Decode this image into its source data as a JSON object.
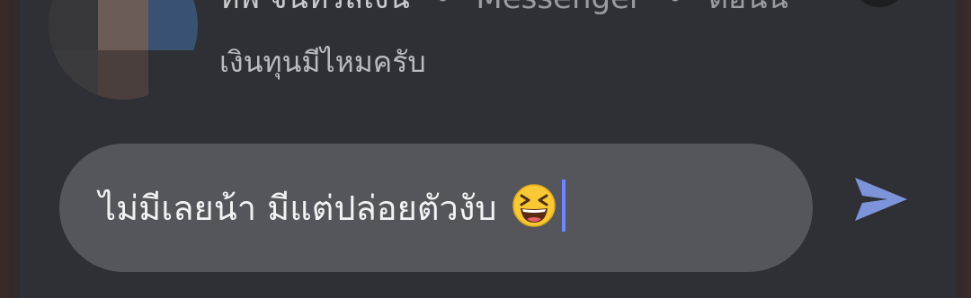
{
  "notification": {
    "sender_name": "ทิพ จันทร์สีเงิน",
    "separator": "•",
    "app_name": "Messenger",
    "separator2": "•",
    "time": "ตอนนี้",
    "message_preview": "เงินทุนมีไหมครับ",
    "avatar_colors": [
      "#a7a8ab",
      "#3a3439",
      "#2f3036",
      "#37363a",
      "#6b5b57",
      "#3a5272",
      "#3b3a3d",
      "#4a3f3c",
      "#2f3036"
    ]
  },
  "reply": {
    "input_text": "ไม่มีเลยน้า มีแต่ปล่อยตัวงับ",
    "emoji": "laughing-face-emoji",
    "send_icon": "send-icon",
    "accent_color": "#6e86ff",
    "send_color": "#7d94db"
  }
}
